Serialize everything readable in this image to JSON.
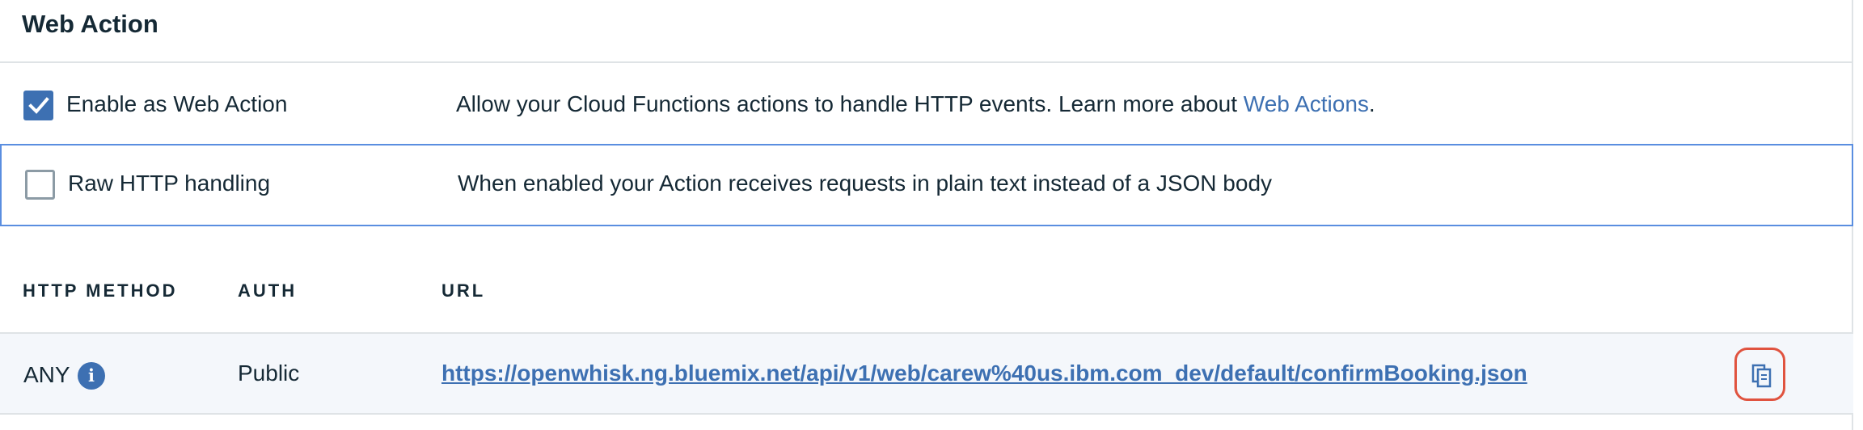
{
  "header": {
    "title": "Web Action"
  },
  "enable_row": {
    "checked": true,
    "label": "Enable as Web Action",
    "description": "Allow your Cloud Functions actions to handle HTTP events. Learn more about ",
    "link_text": "Web Actions",
    "description_end": "."
  },
  "raw_row": {
    "checked": false,
    "label": "Raw HTTP handling",
    "description": "When enabled your Action receives requests in plain text instead of a JSON body"
  },
  "table": {
    "columns": [
      "HTTP METHOD",
      "AUTH",
      "URL"
    ],
    "rows": [
      {
        "method": "ANY",
        "auth": "Public",
        "url": "https://openwhisk.ng.bluemix.net/api/v1/web/carew%40us.ibm.com_dev/default/confirmBooking.json"
      }
    ]
  },
  "icons": {
    "info": "info-icon",
    "copy": "copy-icon",
    "check": "checkmark-icon"
  },
  "colors": {
    "accent": "#3d70b2",
    "highlight": "#e0533f",
    "focus_border": "#5a8ee0"
  }
}
